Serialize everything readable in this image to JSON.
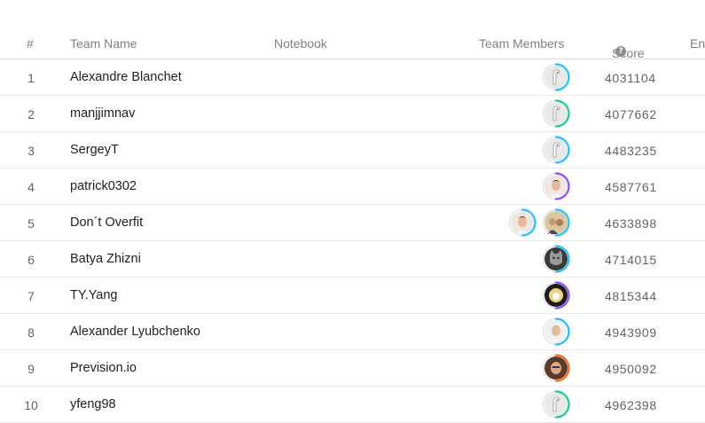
{
  "header": {
    "rank": "#",
    "team_name": "Team Name",
    "notebook": "Notebook",
    "team_members": "Team Members",
    "score": "Score",
    "entries": "En",
    "help_icon": "?"
  },
  "tier_colors": {
    "novice": "#20beff",
    "contributor": "#1ac98e",
    "expert": "#8c4dff",
    "master": "#f96517"
  },
  "rows": [
    {
      "rank": "1",
      "team": "Alexandre Blanchet",
      "score": "4031104",
      "members": [
        {
          "avatar": "default-goose",
          "tier": "novice"
        }
      ]
    },
    {
      "rank": "2",
      "team": "manjjimnav",
      "score": "4077662",
      "members": [
        {
          "avatar": "default-goose",
          "tier": "contributor"
        }
      ]
    },
    {
      "rank": "3",
      "team": "SergeyT",
      "score": "4483235",
      "members": [
        {
          "avatar": "default-goose",
          "tier": "novice"
        }
      ]
    },
    {
      "rank": "4",
      "team": "patrick0302",
      "score": "4587761",
      "members": [
        {
          "avatar": "face-photo",
          "tier": "expert"
        }
      ]
    },
    {
      "rank": "5",
      "team": "Don´t Overfit",
      "score": "4633898",
      "members": [
        {
          "avatar": "face-photo",
          "tier": "novice"
        },
        {
          "avatar": "group-photo",
          "tier": "novice"
        }
      ]
    },
    {
      "rank": "6",
      "team": "Batya Zhizni",
      "score": "4714015",
      "members": [
        {
          "avatar": "cat-photo",
          "tier": "novice"
        }
      ]
    },
    {
      "rank": "7",
      "team": "TY.Yang",
      "score": "4815344",
      "members": [
        {
          "avatar": "cartoon-photo",
          "tier": "expert"
        }
      ]
    },
    {
      "rank": "8",
      "team": "Alexander Lyubchenko",
      "score": "4943909",
      "members": [
        {
          "avatar": "light-face-photo",
          "tier": "novice"
        }
      ]
    },
    {
      "rank": "9",
      "team": "Prevision.io",
      "score": "4950092",
      "members": [
        {
          "avatar": "cartoon-face-photo",
          "tier": "master"
        }
      ]
    },
    {
      "rank": "10",
      "team": "yfeng98",
      "score": "4962398",
      "members": [
        {
          "avatar": "default-goose",
          "tier": "contributor"
        }
      ]
    }
  ]
}
